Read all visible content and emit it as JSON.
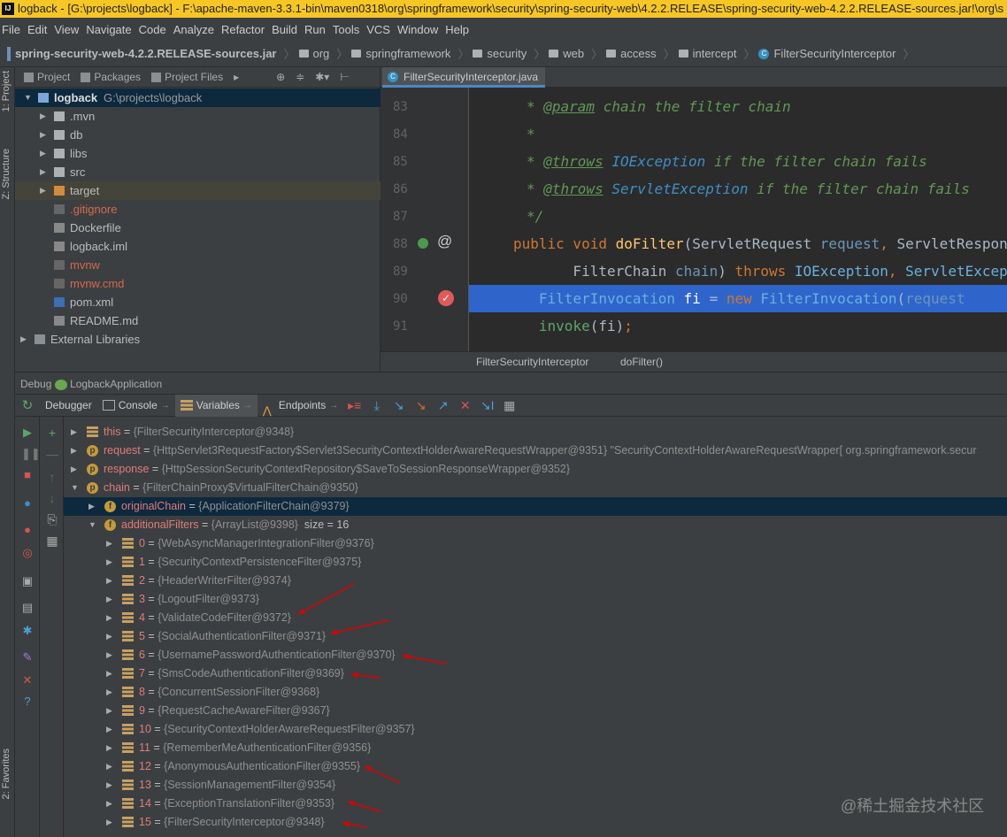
{
  "title": "logback - [G:\\projects\\logback] - F:\\apache-maven-3.3.1-bin\\maven0318\\org\\springframework\\security\\spring-security-web\\4.2.2.RELEASE\\spring-security-web-4.2.2.RELEASE-sources.jar!\\org\\s",
  "menu": [
    "File",
    "Edit",
    "View",
    "Navigate",
    "Code",
    "Analyze",
    "Refactor",
    "Build",
    "Run",
    "Tools",
    "VCS",
    "Window",
    "Help"
  ],
  "breadcrumb": [
    "spring-security-web-4.2.2.RELEASE-sources.jar",
    "org",
    "springframework",
    "security",
    "web",
    "access",
    "intercept",
    "FilterSecurityInterceptor"
  ],
  "stripe": {
    "project": "1: Project",
    "structure": "Z: Structure",
    "favorites": "2: Favorites"
  },
  "project_panel": {
    "tabs": [
      "Project",
      "Packages",
      "Project Files"
    ],
    "root": {
      "name": "logback",
      "path": "G:\\projects\\logback"
    },
    "items": [
      {
        "label": ".mvn",
        "type": "folder",
        "expandable": true
      },
      {
        "label": "db",
        "type": "folder",
        "expandable": true
      },
      {
        "label": "libs",
        "type": "folder",
        "expandable": true
      },
      {
        "label": "src",
        "type": "folder",
        "expandable": true
      },
      {
        "label": "target",
        "type": "folder-excluded",
        "expandable": true
      },
      {
        "label": ".gitignore",
        "type": "file-ignored"
      },
      {
        "label": "Dockerfile",
        "type": "file"
      },
      {
        "label": "logback.iml",
        "type": "file"
      },
      {
        "label": "mvnw",
        "type": "file-ignored"
      },
      {
        "label": "mvnw.cmd",
        "type": "file-ignored"
      },
      {
        "label": "pom.xml",
        "type": "maven"
      },
      {
        "label": "README.md",
        "type": "file"
      }
    ],
    "external": "External Libraries"
  },
  "editor": {
    "tab": "FilterSecurityInterceptor.java",
    "line_numbers": [
      "83",
      "84",
      "85",
      "86",
      "87",
      "88",
      "89",
      "90",
      "91"
    ],
    "breadcrumb": [
      "FilterSecurityInterceptor",
      "doFilter()"
    ]
  },
  "debug": {
    "label": "Debug",
    "config": "LogbackApplication",
    "tabs": [
      "Debugger",
      "Console",
      "Variables",
      "Endpoints"
    ],
    "variables": [
      {
        "name": "this",
        "value": "{FilterSecurityInterceptor@9348}"
      },
      {
        "name": "request",
        "value": "{HttpServlet3RequestFactory$Servlet3SecurityContextHolderAwareRequestWrapper@9351} \"SecurityContextHolderAwareRequestWrapper[ org.springframework.secur"
      },
      {
        "name": "response",
        "value": "{HttpSessionSecurityContextRepository$SaveToSessionResponseWrapper@9352}"
      },
      {
        "name": "chain",
        "value": "{FilterChainProxy$VirtualFilterChain@9350}"
      },
      {
        "name": "originalChain",
        "value": "{ApplicationFilterChain@9379}"
      },
      {
        "name": "additionalFilters",
        "value": "{ArrayList@9398}",
        "size": "size = 16"
      }
    ],
    "filters": [
      "{WebAsyncManagerIntegrationFilter@9376}",
      "{SecurityContextPersistenceFilter@9375}",
      "{HeaderWriterFilter@9374}",
      "{LogoutFilter@9373}",
      "{ValidateCodeFilter@9372}",
      "{SocialAuthenticationFilter@9371}",
      "{UsernamePasswordAuthenticationFilter@9370}",
      "{SmsCodeAuthenticationFilter@9369}",
      "{ConcurrentSessionFilter@9368}",
      "{RequestCacheAwareFilter@9367}",
      "{SecurityContextHolderAwareRequestFilter@9357}",
      "{RememberMeAuthenticationFilter@9356}",
      "{AnonymousAuthenticationFilter@9355}",
      "{SessionManagementFilter@9354}",
      "{ExceptionTranslationFilter@9353}",
      "{FilterSecurityInterceptor@9348}"
    ],
    "highlighted_filter_indexes": [
      4,
      5,
      6,
      7,
      12,
      14,
      15
    ]
  },
  "watermark": "@稀土掘金技术社区",
  "colors": {
    "title_bar": "#f6c624",
    "selection": "#2f65ca",
    "arrow": "#e00000"
  }
}
